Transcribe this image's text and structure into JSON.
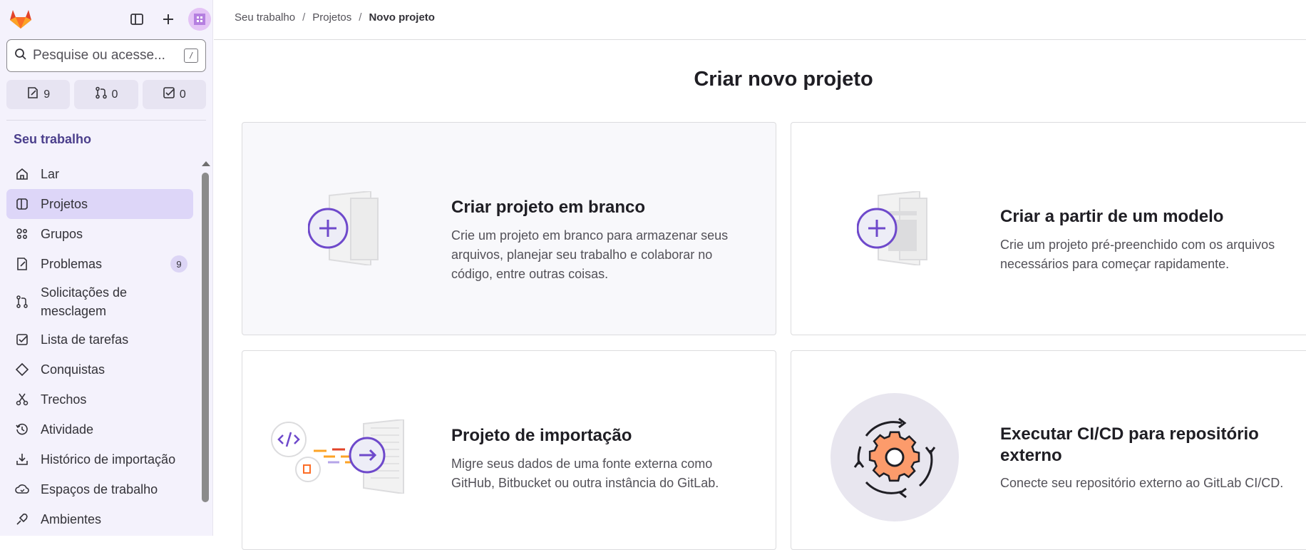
{
  "search": {
    "placeholder": "Pesquise ou acesse...",
    "shortcut": "/"
  },
  "counters": [
    {
      "icon": "issues-icon",
      "count": "9"
    },
    {
      "icon": "merge-request-icon",
      "count": "0"
    },
    {
      "icon": "todo-icon",
      "count": "0"
    }
  ],
  "sidebar": {
    "section_title": "Seu trabalho",
    "items": [
      {
        "label": "Lar",
        "icon": "home-icon"
      },
      {
        "label": "Projetos",
        "icon": "project-icon",
        "active": true
      },
      {
        "label": "Grupos",
        "icon": "group-icon"
      },
      {
        "label": "Problemas",
        "icon": "issues-icon",
        "badge": "9"
      },
      {
        "label": "Solicitações de mesclagem",
        "icon": "merge-request-icon"
      },
      {
        "label": "Lista de tarefas",
        "icon": "todo-icon"
      },
      {
        "label": "Conquistas",
        "icon": "trophy-icon"
      },
      {
        "label": "Trechos",
        "icon": "snippet-icon"
      },
      {
        "label": "Atividade",
        "icon": "history-icon"
      },
      {
        "label": "Histórico de importação",
        "icon": "import-icon"
      },
      {
        "label": "Espaços de trabalho",
        "icon": "workspace-icon"
      },
      {
        "label": "Ambientes",
        "icon": "environment-icon"
      }
    ]
  },
  "breadcrumb": {
    "level1": "Seu trabalho",
    "level2": "Projetos",
    "current": "Novo projeto",
    "separator": "/"
  },
  "main": {
    "title": "Criar novo projeto",
    "cards": [
      {
        "title": "Criar projeto em branco",
        "description": "Crie um projeto em branco para armazenar seus arquivos, planejar seu trabalho e colaborar no código, entre outras coisas."
      },
      {
        "title": "Criar a partir de um modelo",
        "description": "Crie um projeto pré-preenchido com os arquivos necessários para começar rapidamente."
      },
      {
        "title": "Projeto de importação",
        "description": "Migre seus dados de uma fonte externa como GitHub, Bitbucket ou outra instância do GitLab."
      },
      {
        "title": "Executar CI/CD para repositório externo",
        "description": "Conecte seu repositório externo ao GitLab CI/CD."
      }
    ]
  },
  "colors": {
    "accent": "#6e49cb",
    "sidebar_bg": "#f4f2fc",
    "active_bg": "#ddd6f8",
    "orange": "#fc6d26"
  }
}
